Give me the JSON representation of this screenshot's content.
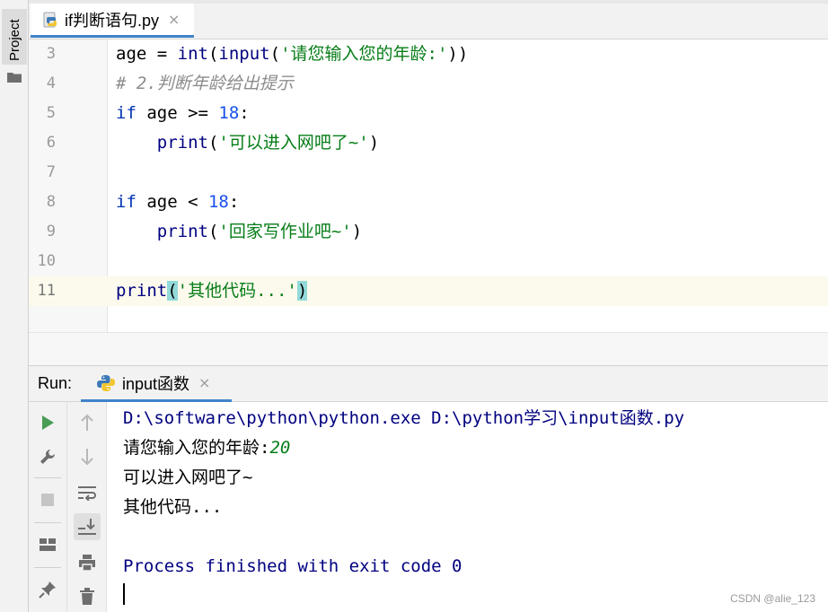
{
  "sidebar": {
    "project_label": "Project"
  },
  "editor_tab": {
    "label": "if判断语句.py",
    "close": "×"
  },
  "code_lines": [
    {
      "ln": "3",
      "segments": [
        {
          "t": "age = ",
          "c": ""
        },
        {
          "t": "int",
          "c": "fn"
        },
        {
          "t": "(",
          "c": ""
        },
        {
          "t": "input",
          "c": "fn"
        },
        {
          "t": "(",
          "c": ""
        },
        {
          "t": "'请您输入您的年龄:'",
          "c": "str"
        },
        {
          "t": "))",
          "c": ""
        }
      ]
    },
    {
      "ln": "4",
      "segments": [
        {
          "t": "# 2.判断年龄给出提示",
          "c": "cmt"
        }
      ]
    },
    {
      "ln": "5",
      "segments": [
        {
          "t": "if",
          "c": "kw"
        },
        {
          "t": " age >= ",
          "c": ""
        },
        {
          "t": "18",
          "c": "num"
        },
        {
          "t": ":",
          "c": ""
        }
      ]
    },
    {
      "ln": "6",
      "segments": [
        {
          "t": "    print",
          "c": "fn"
        },
        {
          "t": "(",
          "c": ""
        },
        {
          "t": "'可以进入网吧了~'",
          "c": "str"
        },
        {
          "t": ")",
          "c": ""
        }
      ]
    },
    {
      "ln": "7",
      "segments": []
    },
    {
      "ln": "8",
      "segments": [
        {
          "t": "if",
          "c": "kw"
        },
        {
          "t": " age < ",
          "c": ""
        },
        {
          "t": "18",
          "c": "num"
        },
        {
          "t": ":",
          "c": ""
        }
      ]
    },
    {
      "ln": "9",
      "segments": [
        {
          "t": "    print",
          "c": "fn"
        },
        {
          "t": "(",
          "c": ""
        },
        {
          "t": "'回家写作业吧~'",
          "c": "str"
        },
        {
          "t": ")",
          "c": ""
        }
      ]
    },
    {
      "ln": "10",
      "segments": []
    },
    {
      "ln": "11",
      "current": true,
      "segments": [
        {
          "t": "print",
          "c": "fn"
        },
        {
          "t": "(",
          "c": "brace"
        },
        {
          "t": "'其他代码...'",
          "c": "str"
        },
        {
          "t": ")",
          "c": "brace"
        }
      ]
    }
  ],
  "run": {
    "label": "Run:",
    "tab_label": "input函数",
    "tab_close": "×"
  },
  "console": {
    "command": "D:\\software\\python\\python.exe D:\\python学习\\input函数.py",
    "prompt": "请您输入您的年龄:",
    "input_value": "20",
    "output1": "可以进入网吧了~",
    "output2": "其他代码...",
    "finished": "Process finished with exit code 0"
  },
  "watermark": "CSDN @alie_123",
  "icons": {
    "left_tools": [
      "run-icon",
      "wrench-icon",
      "stop-icon",
      "layout-icon",
      "pin-icon"
    ],
    "right_tools": [
      "arrow-up-icon",
      "arrow-down-icon",
      "soft-wrap-icon",
      "scroll-to-end-icon",
      "print-icon",
      "trash-icon"
    ]
  },
  "colors": {
    "keyword": "#0033b3",
    "number": "#1750eb",
    "string": "#067d17",
    "comment": "#8c8c8c",
    "console_system": "#000080",
    "accent": "#4083c9",
    "run_green": "#499c54"
  }
}
